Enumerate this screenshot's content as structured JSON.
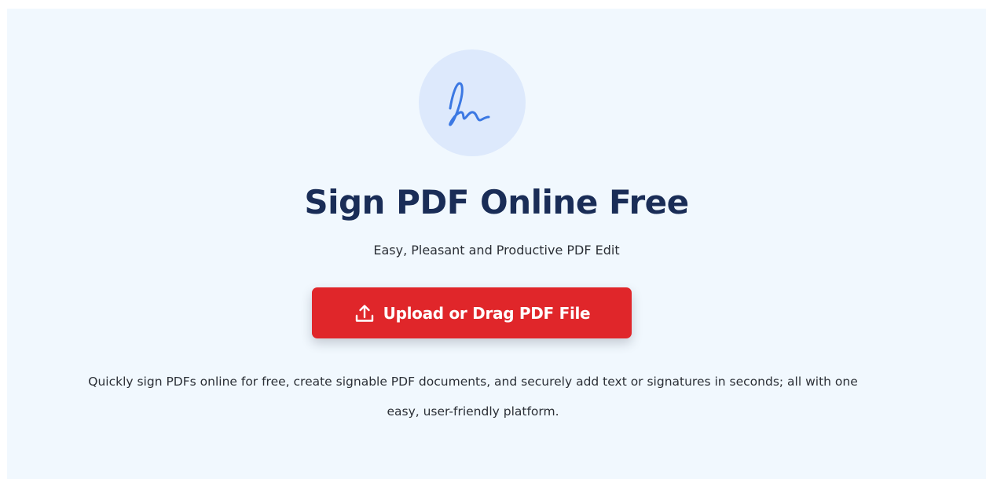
{
  "hero": {
    "icon": "signature-icon",
    "title": "Sign PDF Online Free",
    "subtitle": "Easy, Pleasant and Productive PDF Edit",
    "upload_button": {
      "icon": "upload-icon",
      "label": "Upload or Drag PDF File"
    },
    "description": "Quickly sign PDFs online for free, create signable PDF documents, and securely add text or signatures in seconds; all with one easy, user-friendly platform."
  },
  "colors": {
    "panel_background": "#f1f8fe",
    "icon_circle": "#dde9fc",
    "icon_stroke": "#3b78e3",
    "title": "#1a2d57",
    "button": "#e0262a",
    "button_text": "#ffffff",
    "body_text": "#2b2f36"
  }
}
